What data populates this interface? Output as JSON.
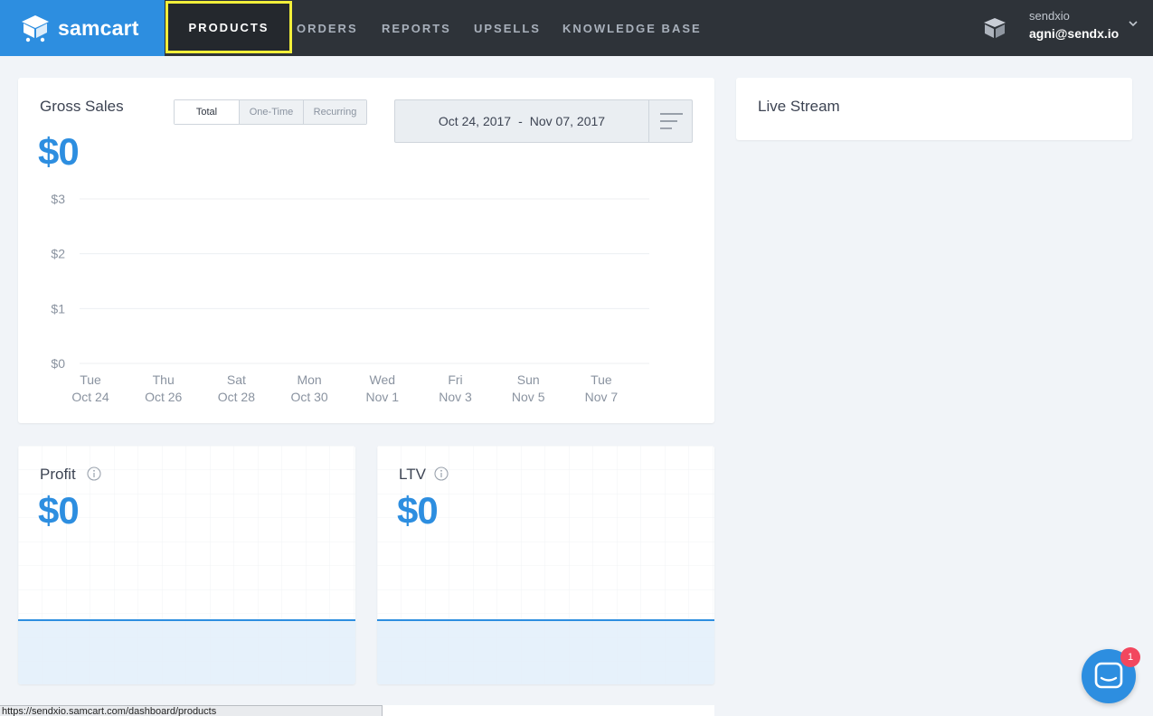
{
  "brand": {
    "name": "samcart"
  },
  "nav": {
    "items": [
      {
        "label": "PRODUCTS",
        "active": true
      },
      {
        "label": "ORDERS"
      },
      {
        "label": "REPORTS"
      },
      {
        "label": "UPSELLS"
      },
      {
        "label": "KNOWLEDGE BASE"
      }
    ]
  },
  "user": {
    "name": "sendxio",
    "email": "agni@sendx.io"
  },
  "gross_sales": {
    "title": "Gross Sales",
    "value": "$0",
    "toggle": [
      "Total",
      "One-Time",
      "Recurring"
    ],
    "date_start": "Oct 24, 2017",
    "date_sep": "-",
    "date_end": "Nov 07, 2017"
  },
  "chart_data": {
    "type": "line",
    "y_ticks": [
      "$3",
      "$2",
      "$1",
      "$0"
    ],
    "ylim": [
      0,
      3
    ],
    "x_ticks": [
      {
        "day": "Tue",
        "date": "Oct 24"
      },
      {
        "day": "Thu",
        "date": "Oct 26"
      },
      {
        "day": "Sat",
        "date": "Oct 28"
      },
      {
        "day": "Mon",
        "date": "Oct 30"
      },
      {
        "day": "Wed",
        "date": "Nov 1"
      },
      {
        "day": "Fri",
        "date": "Nov 3"
      },
      {
        "day": "Sun",
        "date": "Nov 5"
      },
      {
        "day": "Tue",
        "date": "Nov 7"
      }
    ],
    "grid": true
  },
  "profit": {
    "title": "Profit",
    "value": "$0"
  },
  "ltv": {
    "title": "LTV",
    "value": "$0"
  },
  "live_stream": {
    "title": "Live Stream"
  },
  "status_bar": {
    "url": "https://sendxio.samcart.com/dashboard/products"
  },
  "chat": {
    "badge": "1"
  },
  "colors": {
    "accent": "#2d8ee0",
    "nav_bg": "#2e3339",
    "highlight": "#f2ef3a"
  }
}
